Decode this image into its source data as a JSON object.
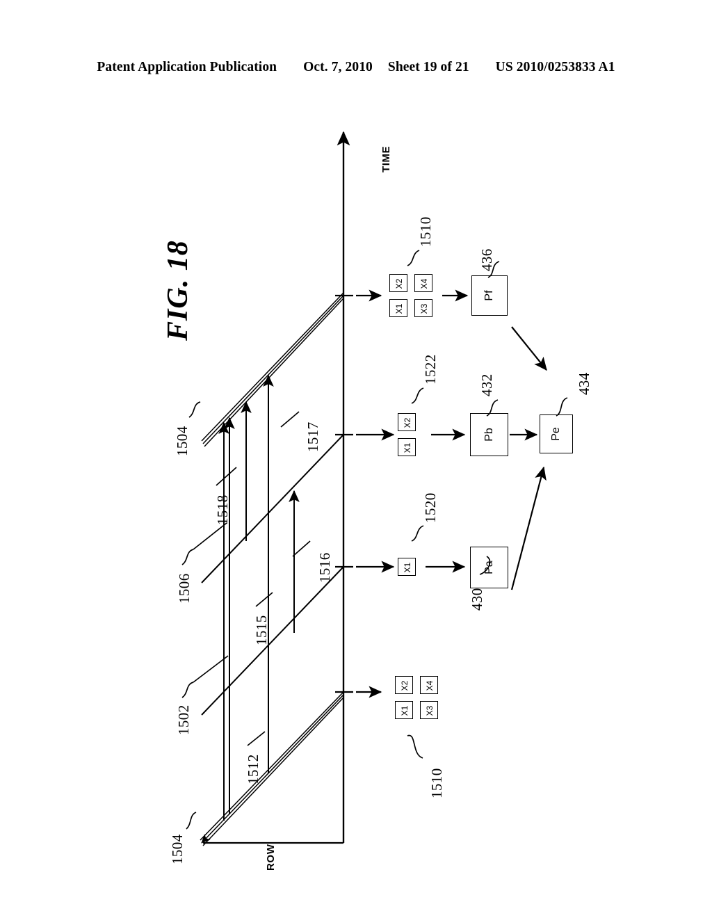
{
  "header": {
    "publication": "Patent Application Publication",
    "date": "Oct. 7, 2010",
    "sheet": "Sheet 19 of 21",
    "docnumber": "US 2010/0253833 A1"
  },
  "figure": {
    "title": "FIG. 18",
    "axes": {
      "time_label": "TIME",
      "row_label": "ROW"
    },
    "reference_numerals": {
      "n1502": "1502",
      "n1504_top": "1504",
      "n1504_bottom": "1504",
      "n1506": "1506",
      "n1510_top": "1510",
      "n1510_bottom": "1510",
      "n1512": "1512",
      "n1515": "1515",
      "n1516": "1516",
      "n1517": "1517",
      "n1518": "1518",
      "n1520": "1520",
      "n1522": "1522",
      "n430": "430",
      "n432": "432",
      "n434": "434",
      "n436": "436"
    },
    "cell_groups": [
      {
        "id": "group-bottom",
        "ref": "1510",
        "cells": [
          "X1",
          "X2",
          "X3",
          "X4"
        ]
      },
      {
        "id": "group-row1",
        "ref": "1520",
        "cells": [
          "X1"
        ]
      },
      {
        "id": "group-row2",
        "ref": "1522",
        "cells": [
          "X1",
          "X2"
        ]
      },
      {
        "id": "group-row3",
        "ref": "1510",
        "cells": [
          "X1",
          "X2",
          "X3",
          "X4"
        ]
      }
    ],
    "process_boxes": [
      {
        "id": "pa",
        "label": "Pa",
        "ref": "430"
      },
      {
        "id": "pb",
        "label": "Pb",
        "ref": "432"
      },
      {
        "id": "pe",
        "label": "Pe",
        "ref": "434"
      },
      {
        "id": "pf",
        "label": "Pf",
        "ref": "436"
      }
    ]
  }
}
